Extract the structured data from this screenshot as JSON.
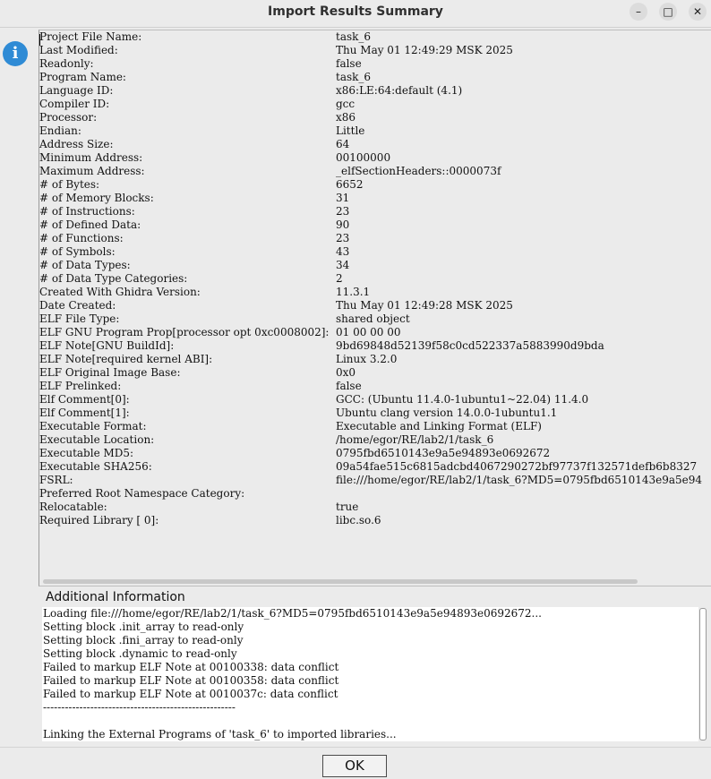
{
  "window": {
    "title": "Import Results Summary",
    "minimize": "–",
    "maximize": "□",
    "close": "✕"
  },
  "icon": {
    "name": "info-icon",
    "glyph": "i",
    "color": "#2f8bd5"
  },
  "properties": [
    {
      "key": "Project File Name:",
      "value": "task_6"
    },
    {
      "key": "Last Modified:",
      "value": "Thu May 01 12:49:29 MSK 2025"
    },
    {
      "key": "Readonly:",
      "value": "false"
    },
    {
      "key": "Program Name:",
      "value": "task_6"
    },
    {
      "key": "Language ID:",
      "value": "x86:LE:64:default (4.1)"
    },
    {
      "key": "Compiler ID:",
      "value": "gcc"
    },
    {
      "key": "Processor:",
      "value": "x86"
    },
    {
      "key": "Endian:",
      "value": "Little"
    },
    {
      "key": "Address Size:",
      "value": "64"
    },
    {
      "key": "Minimum Address:",
      "value": "00100000"
    },
    {
      "key": "Maximum Address:",
      "value": "_elfSectionHeaders::0000073f"
    },
    {
      "key": "# of Bytes:",
      "value": "6652"
    },
    {
      "key": "# of Memory Blocks:",
      "value": "31"
    },
    {
      "key": "# of Instructions:",
      "value": "23"
    },
    {
      "key": "# of Defined Data:",
      "value": "90"
    },
    {
      "key": "# of Functions:",
      "value": "23"
    },
    {
      "key": "# of Symbols:",
      "value": "43"
    },
    {
      "key": "# of Data Types:",
      "value": "34"
    },
    {
      "key": "# of Data Type Categories:",
      "value": "2"
    },
    {
      "key": "Created With Ghidra Version:",
      "value": "11.3.1"
    },
    {
      "key": "Date Created:",
      "value": "Thu May 01 12:49:28 MSK 2025"
    },
    {
      "key": "ELF File Type:",
      "value": "shared object"
    },
    {
      "key": "ELF GNU Program Prop[processor opt 0xc0008002]:",
      "value": "01 00 00 00"
    },
    {
      "key": "ELF Note[GNU BuildId]:",
      "value": "9bd69848d52139f58c0cd522337a5883990d9bda"
    },
    {
      "key": "ELF Note[required kernel ABI]:",
      "value": "Linux 3.2.0"
    },
    {
      "key": "ELF Original Image Base:",
      "value": "0x0"
    },
    {
      "key": "ELF Prelinked:",
      "value": "false"
    },
    {
      "key": "Elf Comment[0]:",
      "value": "GCC: (Ubuntu 11.4.0-1ubuntu1~22.04) 11.4.0"
    },
    {
      "key": "Elf Comment[1]:",
      "value": "Ubuntu clang version 14.0.0-1ubuntu1.1"
    },
    {
      "key": "Executable Format:",
      "value": "Executable and Linking Format (ELF)"
    },
    {
      "key": "Executable Location:",
      "value": "/home/egor/RE/lab2/1/task_6"
    },
    {
      "key": "Executable MD5:",
      "value": "0795fbd6510143e9a5e94893e0692672"
    },
    {
      "key": "Executable SHA256:",
      "value": "09a54fae515c6815adcbd4067290272bf97737f132571defb6b8327"
    },
    {
      "key": "FSRL:",
      "value": "file:///home/egor/RE/lab2/1/task_6?MD5=0795fbd6510143e9a5e94"
    },
    {
      "key": "Preferred Root Namespace Category:",
      "value": ""
    },
    {
      "key": "Relocatable:",
      "value": "true"
    },
    {
      "key": "Required Library [    0]:",
      "value": "libc.so.6"
    }
  ],
  "additional_info": {
    "label": "Additional Information",
    "lines": [
      "Loading file:///home/egor/RE/lab2/1/task_6?MD5=0795fbd6510143e9a5e94893e0692672...",
      "Setting block .init_array to read-only",
      "Setting block .fini_array to read-only",
      "Setting block .dynamic to read-only",
      "Failed to markup ELF Note at 00100338: data conflict",
      "Failed to markup ELF Note at 00100358: data conflict",
      "Failed to markup ELF Note at 0010037c: data conflict",
      "-----------------------------------------------------",
      "",
      "Linking the External Programs of 'task_6' to imported libraries..."
    ]
  },
  "buttons": {
    "ok": "OK"
  }
}
